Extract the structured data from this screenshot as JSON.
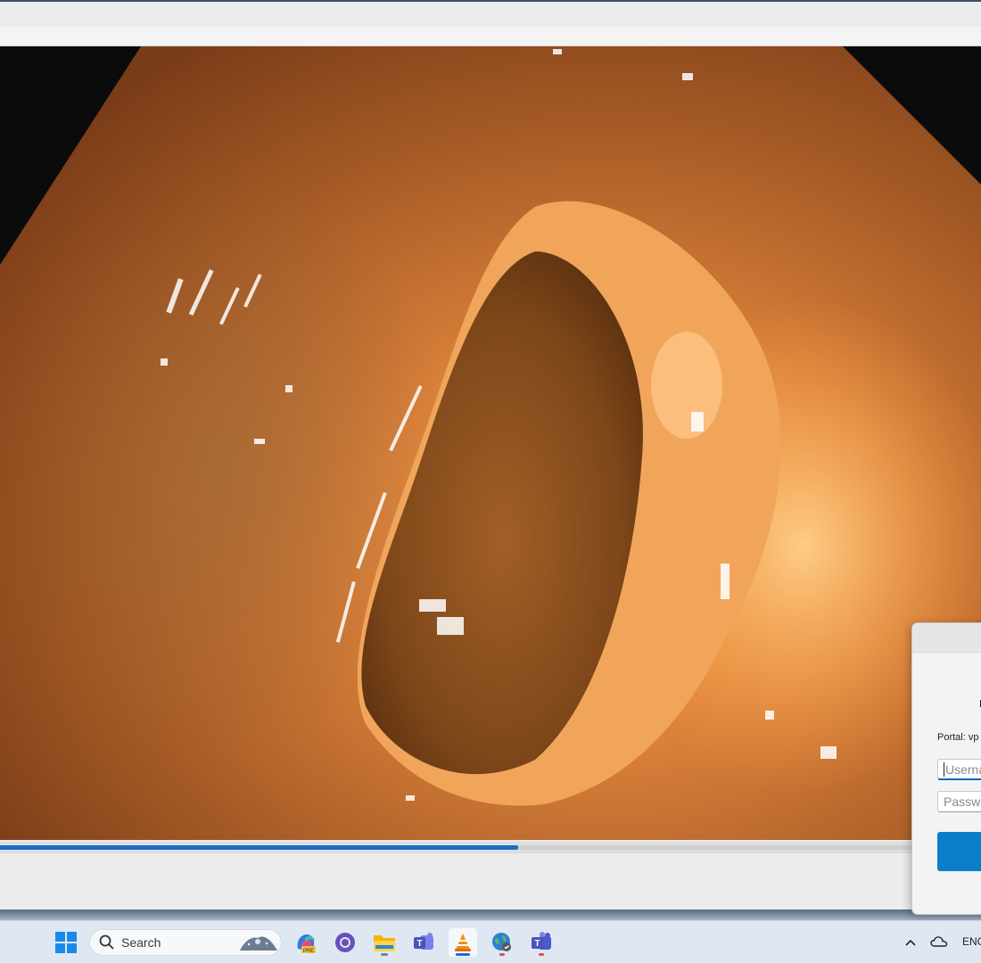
{
  "window": {
    "progress_fraction": 0.528
  },
  "dialog": {
    "portal_label": "Portal: vp",
    "username_placeholder": "Userna",
    "password_placeholder": "Passwo"
  },
  "taskbar": {
    "search_label": "Search",
    "apps": [
      "start-icon",
      "copilot-icon",
      "github-icon",
      "file-explorer-icon",
      "teams-classic-icon",
      "vlc-icon",
      "browser-icon",
      "teams-icon"
    ],
    "tray": {
      "language": "ENG",
      "icons": [
        "chevron-up-icon",
        "onedrive-cloud-icon"
      ]
    }
  },
  "colors": {
    "accent": "#1c6ec6",
    "dialog_button": "#0a7fc9",
    "taskbar": "#dfe8f2"
  }
}
